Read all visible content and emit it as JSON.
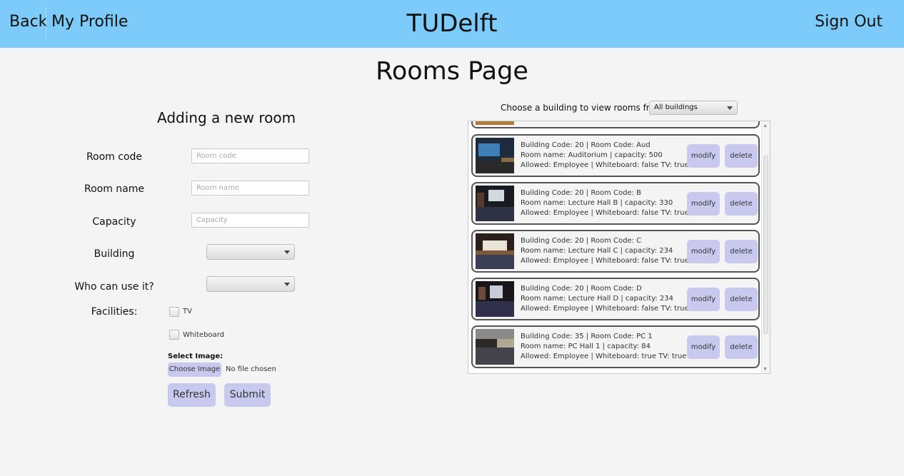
{
  "header": {
    "back": "Back",
    "profile": "My Profile",
    "brand": "TUDelft",
    "signout": "Sign Out"
  },
  "page_title": "Rooms Page",
  "form": {
    "title": "Adding a new room",
    "room_code_label": "Room code",
    "room_code_placeholder": "Room code",
    "room_name_label": "Room name",
    "room_name_placeholder": "Room name",
    "capacity_label": "Capacity",
    "capacity_placeholder": "Capacity",
    "building_label": "Building",
    "who_label": "Who can use it?",
    "facilities_label": "Facilities:",
    "tv_label": "TV",
    "whiteboard_label": "Whiteboard",
    "select_image_label": "Select Image:",
    "choose_image": "Choose Image",
    "no_file": "No file chosen",
    "refresh": "Refresh",
    "submit": "Submit"
  },
  "filter": {
    "label": "Choose a building to view rooms from",
    "selected": "All buildings"
  },
  "rooms": [
    {
      "line1": "Building Code: 20 | Room Code: Aud",
      "line2": "Room name: Auditorium | capacity: 500",
      "line3": "Allowed: Employee | Whiteboard: false TV: true",
      "modify": "modify",
      "delete": "delete"
    },
    {
      "line1": "Building Code: 20 | Room Code: B",
      "line2": "Room name: Lecture Hall B | capacity: 330",
      "line3": "Allowed: Employee | Whiteboard: false TV: true",
      "modify": "modify",
      "delete": "delete"
    },
    {
      "line1": "Building Code: 20 | Room Code: C",
      "line2": "Room name: Lecture Hall C | capacity: 234",
      "line3": "Allowed: Employee | Whiteboard: false TV: true",
      "modify": "modify",
      "delete": "delete"
    },
    {
      "line1": "Building Code: 20 | Room Code: D",
      "line2": "Room name: Lecture Hall D | capacity: 234",
      "line3": "Allowed: Employee | Whiteboard: false TV: true",
      "modify": "modify",
      "delete": "delete"
    },
    {
      "line1": "Building Code: 35 | Room Code: PC 1",
      "line2": "Room name: PC Hall 1 | capacity: 84",
      "line3": "Allowed: Employee | Whiteboard: true TV: true",
      "modify": "modify",
      "delete": "delete"
    }
  ],
  "colors": {
    "header_bg": "#7ccbfa",
    "button_bg": "#c9c9f0"
  }
}
